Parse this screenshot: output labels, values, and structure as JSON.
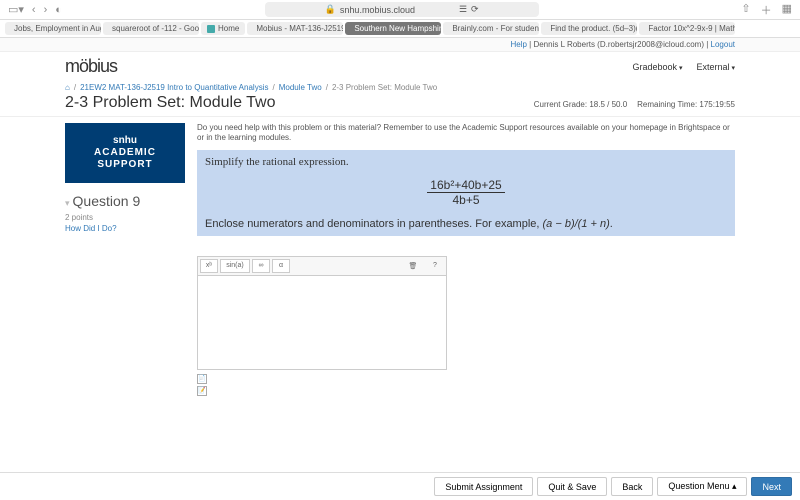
{
  "browser": {
    "url": "snhu.mobius.cloud",
    "tabs": [
      {
        "label": "Jobs, Employment in Aug…",
        "fav": "b"
      },
      {
        "label": "squareroot of -112 - Goo…",
        "fav": "g"
      },
      {
        "label": "Home",
        "fav": "home"
      },
      {
        "label": "Mobius - MAT-136-J2519…",
        "fav": "b"
      },
      {
        "label": "Southern New Hampshire…",
        "fav": "b",
        "active": true
      },
      {
        "label": "Brainly.com - For student…",
        "fav": "b"
      },
      {
        "label": "Find the product. (5d–3)(…",
        "fav": "g"
      },
      {
        "label": "Factor 10x^2-9x-9 | Math…",
        "fav": "r"
      }
    ]
  },
  "topbar": {
    "help": "Help",
    "user": "Dennis L Roberts (D.robertsjr2008@icloud.com)",
    "logout": "Logout"
  },
  "logo": "möbius",
  "nav": {
    "gradebook": "Gradebook",
    "external": "External"
  },
  "breadcrumb": {
    "home": "⌂",
    "course": "21EW2 MAT-136-J2519 Intro to Quantitative Analysis",
    "module": "Module Two",
    "current": "2-3 Problem Set: Module Two"
  },
  "page_title": "2-3 Problem Set: Module Two",
  "status": {
    "grade_label": "Current Grade:",
    "grade_value": "18.5 / 50.0",
    "time_label": "Remaining Time:",
    "time_value": "175:19:55"
  },
  "support": {
    "line1": "snhu",
    "line2": "ACADEMIC SUPPORT"
  },
  "help_text": "Do you need help with this problem or this material? Remember to use the Academic Support resources available on your homepage in Brightspace or or in the learning modules.",
  "question": {
    "title": "Question 9",
    "points": "2 points",
    "howdid": "How Did I Do?"
  },
  "problem": {
    "prompt": "Simplify the rational expression.",
    "formula_num": "16b²+40b+25",
    "formula_den": "4b+5",
    "hint_pre": "Enclose numerators and denominators in parentheses. For example, ",
    "hint_expr": "(a − b)/(1 + n)",
    "hint_post": "."
  },
  "toolbar": {
    "sigma": "xᵇ",
    "sin": "sin(a)",
    "inf": "∞",
    "alpha": "α",
    "trash": "🗑",
    "help": "?"
  },
  "footer": {
    "submit": "Submit Assignment",
    "quit": "Quit & Save",
    "back": "Back",
    "menu": "Question Menu ▴",
    "next": "Next"
  }
}
